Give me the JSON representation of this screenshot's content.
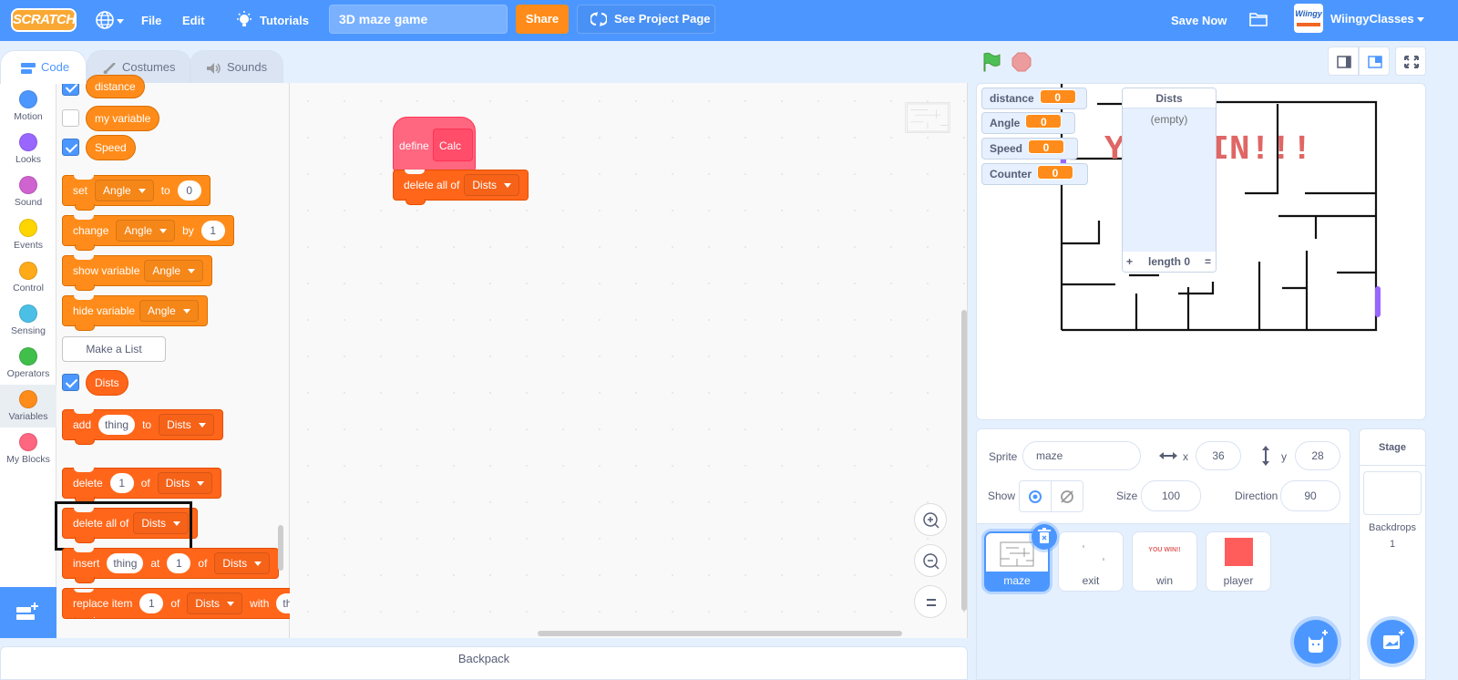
{
  "menubar": {
    "logo": "SCRATCH",
    "file": "File",
    "edit": "Edit",
    "tutorials": "Tutorials",
    "project_title": "3D maze game",
    "share": "Share",
    "see_project_page": "See Project Page",
    "save_now": "Save Now",
    "avatar_text": "Wiingy",
    "username": "WiingyClasses"
  },
  "tabs": [
    {
      "label": "Code",
      "active": true
    },
    {
      "label": "Costumes"
    },
    {
      "label": "Sounds"
    }
  ],
  "categories": [
    {
      "label": "Motion",
      "color": "#4c97ff"
    },
    {
      "label": "Looks",
      "color": "#9966ff"
    },
    {
      "label": "Sound",
      "color": "#cf63cf"
    },
    {
      "label": "Events",
      "color": "#ffd500"
    },
    {
      "label": "Control",
      "color": "#ffab19"
    },
    {
      "label": "Sensing",
      "color": "#4cbfe6"
    },
    {
      "label": "Operators",
      "color": "#40bf4a"
    },
    {
      "label": "Variables",
      "color": "#ff8c1a",
      "active": true
    },
    {
      "label": "My Blocks",
      "color": "#ff6680"
    }
  ],
  "palette": {
    "variables": [
      {
        "name": "distance",
        "checked": true
      },
      {
        "name": "my variable",
        "checked": false
      },
      {
        "name": "Speed",
        "checked": true
      }
    ],
    "set_block": {
      "kw": "set",
      "var": "Angle",
      "to": "to",
      "value": "0"
    },
    "change_block": {
      "kw": "change",
      "var": "Angle",
      "by": "by",
      "value": "1"
    },
    "show_var_block": {
      "kw": "show variable",
      "var": "Angle"
    },
    "hide_var_block": {
      "kw": "hide variable",
      "var": "Angle"
    },
    "make_list": "Make a List",
    "list_reporter": {
      "name": "Dists",
      "checked": true
    },
    "add_block": {
      "kw": "add",
      "item": "thing",
      "to": "to",
      "list": "Dists"
    },
    "delete_block": {
      "kw": "delete",
      "index": "1",
      "of": "of",
      "list": "Dists"
    },
    "delete_all_block": {
      "kw": "delete all of",
      "list": "Dists"
    },
    "insert_block": {
      "kw": "insert",
      "item": "thing",
      "at": "at",
      "index": "1",
      "of": "of",
      "list": "Dists"
    },
    "replace_block": {
      "kw": "replace item",
      "index": "1",
      "of": "of",
      "list": "Dists",
      "with": "with",
      "item": "thing"
    }
  },
  "workspace": {
    "define_block": {
      "kw": "define",
      "name": "Calc"
    },
    "delete_all_block": {
      "kw": "delete all of",
      "list": "Dists"
    }
  },
  "backpack": "Backpack",
  "stage": {
    "monitors": [
      {
        "label": "distance",
        "value": "0"
      },
      {
        "label": "Angle",
        "value": "0"
      },
      {
        "label": "Speed",
        "value": "0"
      },
      {
        "label": "Counter",
        "value": "0"
      }
    ],
    "list_monitor": {
      "title": "Dists",
      "empty": "(empty)",
      "add": "+",
      "length": "length 0",
      "resize": "="
    },
    "win_text": "YOU WIN!!!"
  },
  "sprite_info": {
    "sprite_label": "Sprite",
    "sprite_name": "maze",
    "x_label": "x",
    "x": "36",
    "y_label": "y",
    "y": "28",
    "show_label": "Show",
    "size_label": "Size",
    "size": "100",
    "direction_label": "Direction",
    "direction": "90"
  },
  "sprites": [
    {
      "name": "maze",
      "selected": true
    },
    {
      "name": "exit"
    },
    {
      "name": "win",
      "thumb_text": "YOU WIN!!"
    },
    {
      "name": "player",
      "color": "#ff5c5c"
    }
  ],
  "stage_selector": {
    "title": "Stage",
    "backdrops_label": "Backdrops",
    "backdrops_count": "1"
  }
}
